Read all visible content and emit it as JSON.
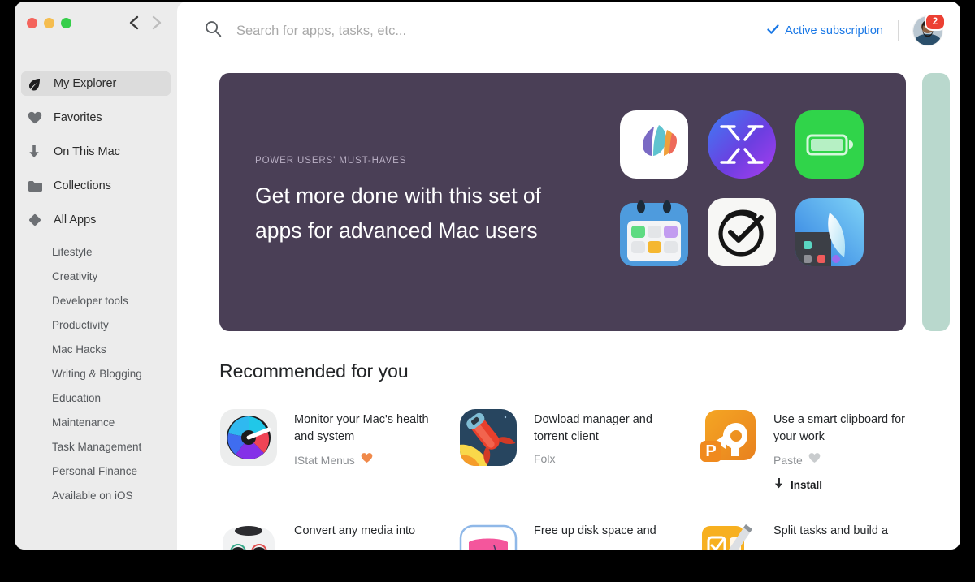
{
  "window": {
    "traffic_lights": [
      "close",
      "minimize",
      "zoom"
    ],
    "nav": {
      "back": "back-arrow",
      "forward": "forward-arrow"
    }
  },
  "sidebar": {
    "items": [
      {
        "label": "My Explorer",
        "icon": "leaf-icon",
        "selected": true,
        "sub": false
      },
      {
        "label": "Favorites",
        "icon": "heart-icon",
        "selected": false,
        "sub": false
      },
      {
        "label": "On This Mac",
        "icon": "download-icon",
        "selected": false,
        "sub": false
      },
      {
        "label": "Collections",
        "icon": "folder-icon",
        "selected": false,
        "sub": false
      },
      {
        "label": "All Apps",
        "icon": "diamond-icon",
        "selected": false,
        "sub": false
      },
      {
        "label": "Lifestyle",
        "icon": "",
        "selected": false,
        "sub": true
      },
      {
        "label": "Creativity",
        "icon": "",
        "selected": false,
        "sub": true
      },
      {
        "label": "Developer tools",
        "icon": "",
        "selected": false,
        "sub": true
      },
      {
        "label": "Productivity",
        "icon": "",
        "selected": false,
        "sub": true
      },
      {
        "label": "Mac Hacks",
        "icon": "",
        "selected": false,
        "sub": true
      },
      {
        "label": "Writing & Blogging",
        "icon": "",
        "selected": false,
        "sub": true
      },
      {
        "label": "Education",
        "icon": "",
        "selected": false,
        "sub": true
      },
      {
        "label": "Maintenance",
        "icon": "",
        "selected": false,
        "sub": true
      },
      {
        "label": "Task Management",
        "icon": "",
        "selected": false,
        "sub": true
      },
      {
        "label": "Personal Finance",
        "icon": "",
        "selected": false,
        "sub": true
      },
      {
        "label": "Available on iOS",
        "icon": "",
        "selected": false,
        "sub": true
      }
    ]
  },
  "topbar": {
    "search": {
      "value": "",
      "placeholder": "Search for apps, tasks, etc..."
    },
    "search_icon": "search-icon",
    "subscription": {
      "label": "Active subscription",
      "icon": "checkmark-icon",
      "color": "#1877e6"
    },
    "avatar": {
      "badge_count": "2",
      "badge_color": "#ec4033"
    }
  },
  "hero": {
    "background": "#4a3f56",
    "eyebrow": "POWER USERS' MUST-HAVES",
    "title": "Get more done with this set of apps for advanced Mac users",
    "apps": [
      {
        "name": "craft-app-icon"
      },
      {
        "name": "mosaic-app-icon"
      },
      {
        "name": "endurance-battery-app-icon"
      },
      {
        "name": "calendar-app-icon"
      },
      {
        "name": "timing-app-icon"
      },
      {
        "name": "cleanshot-app-icon"
      }
    ],
    "peek_card_color": "#b9d8cd"
  },
  "recommended": {
    "title": "Recommended for you",
    "cards": [
      {
        "desc": "Monitor your Mac's health and system",
        "app": "IStat Menus",
        "heart": "♥",
        "heart_color": "#f0894a",
        "install": null,
        "icon": "istat-menus-icon"
      },
      {
        "desc": "Dowload manager and torrent client",
        "app": "Folx",
        "heart": "",
        "heart_color": "",
        "install": null,
        "icon": "folx-icon"
      },
      {
        "desc": "Use a smart clipboard for your work",
        "app": "Paste",
        "heart": "♥",
        "heart_color": "#c9ccce",
        "install": "Install",
        "icon": "paste-icon"
      },
      {
        "desc": "Convert any media into",
        "app": "",
        "heart": "",
        "heart_color": "",
        "install": null,
        "icon": "permute-robot-icon"
      },
      {
        "desc": "Free up disk space and",
        "app": "",
        "heart": "",
        "heart_color": "",
        "install": null,
        "icon": "cleanmymac-icon"
      },
      {
        "desc": "Split tasks and build a",
        "app": "",
        "heart": "",
        "heart_color": "",
        "install": null,
        "icon": "taskpaper-icon"
      }
    ]
  }
}
